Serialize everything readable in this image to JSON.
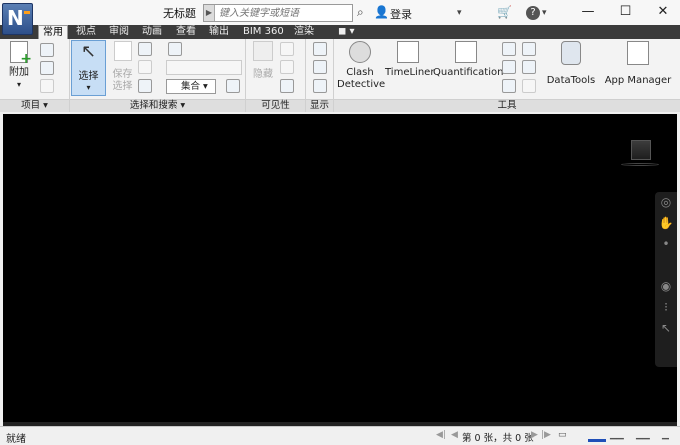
{
  "titlebar": {
    "doc_title": "无标题",
    "search_placeholder": "键入关键字或短语",
    "search_arrow": "▶",
    "login_label": "登录",
    "help_label": "?",
    "window": {
      "minimize": "—",
      "maximize": "☐",
      "close": "✕"
    }
  },
  "app_button": {
    "letter": "N"
  },
  "tabs": [
    {
      "label": "常用",
      "active": true
    },
    {
      "label": "视点"
    },
    {
      "label": "审阅"
    },
    {
      "label": "动画"
    },
    {
      "label": "查看"
    },
    {
      "label": "输出"
    },
    {
      "label": "BIM 360"
    },
    {
      "label": "渲染"
    },
    {
      "label": "◼ ▾"
    }
  ],
  "ribbon": {
    "project": {
      "append_label": "附加",
      "panel_label": "项目 ▾"
    },
    "select": {
      "select_label": "选择",
      "save_label": "保存",
      "save_label2": "选择",
      "set_label": "集合",
      "panel_label": "选择和搜索 ▾"
    },
    "visibility": {
      "hide_label": "隐藏",
      "panel_label": "可见性"
    },
    "display": {
      "panel_label": "显示"
    },
    "tools": {
      "clash_label": "Clash",
      "clash_label2": "Detective",
      "timeliner_label": "TimeLiner",
      "quant_label": "Quantification",
      "datatools_label": "DataTools",
      "appmgr_label": "App Manager",
      "panel_label": "工具"
    }
  },
  "status": {
    "ready": "就绪",
    "page_info": "第 0 张，共 0 张"
  },
  "colors": {
    "accent": "#1f4fb8",
    "tabbar": "#3b3b3b",
    "viewport": "#000000"
  }
}
